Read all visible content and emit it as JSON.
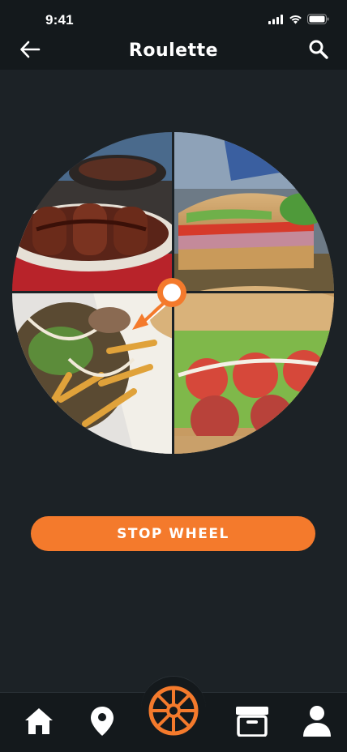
{
  "status": {
    "time": "9:41"
  },
  "header": {
    "title": "Roulette",
    "back_icon": "arrow-left-icon",
    "search_icon": "search-icon"
  },
  "wheel": {
    "segments": [
      "enchiladas",
      "sub-sandwich",
      "loaded-fries",
      "italian-hoagie"
    ],
    "pointer_color": "#f47a2c"
  },
  "actions": {
    "stop_label": "STOP WHEEL"
  },
  "tabs": [
    {
      "icon": "home-icon"
    },
    {
      "icon": "map-pin-icon"
    },
    {
      "icon": "roulette-wheel-icon",
      "active": true
    },
    {
      "icon": "archive-box-icon"
    },
    {
      "icon": "user-icon"
    }
  ],
  "colors": {
    "accent": "#f47a2c",
    "background": "#1c2226",
    "bar": "#14191c"
  }
}
